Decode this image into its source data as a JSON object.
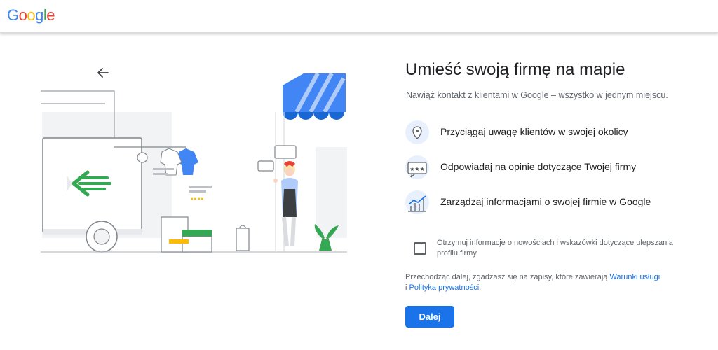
{
  "header": {
    "logo_letters": [
      {
        "ch": "G",
        "color": "#4285F4"
      },
      {
        "ch": "o",
        "color": "#EA4335"
      },
      {
        "ch": "o",
        "color": "#FBBC05"
      },
      {
        "ch": "g",
        "color": "#4285F4"
      },
      {
        "ch": "l",
        "color": "#34A853"
      },
      {
        "ch": "e",
        "color": "#EA4335"
      }
    ]
  },
  "main": {
    "title": "Umieść swoją firmę na mapie",
    "subtitle": "Nawiąż kontakt z klientami w Google – wszystko w jednym miejscu.",
    "features": [
      {
        "icon": "map-pin-icon",
        "label": "Przyciągaj uwagę klientów w swojej okolicy"
      },
      {
        "icon": "review-stars-icon",
        "label": "Odpowiadaj na opinie dotyczące Twojej firmy"
      },
      {
        "icon": "analytics-chart-icon",
        "label": "Zarządzaj informacjami o swojej firmie w Google"
      }
    ],
    "checkbox_label": "Otrzymuj informacje o nowościach i wskazówki dotyczące ulepszania profilu firmy",
    "checkbox_checked": false,
    "terms_prefix": "Przechodząc dalej, zgadzasz się na zapisy, które zawierają ",
    "terms_link": "Warunki usługi",
    "terms_and": " i ",
    "privacy_link": "Polityka prywatności",
    "terms_suffix": ".",
    "next_button": "Dalej"
  },
  "colors": {
    "primary": "#1a73e8",
    "green": "#34A853",
    "awning_blue": "#4285F4"
  }
}
